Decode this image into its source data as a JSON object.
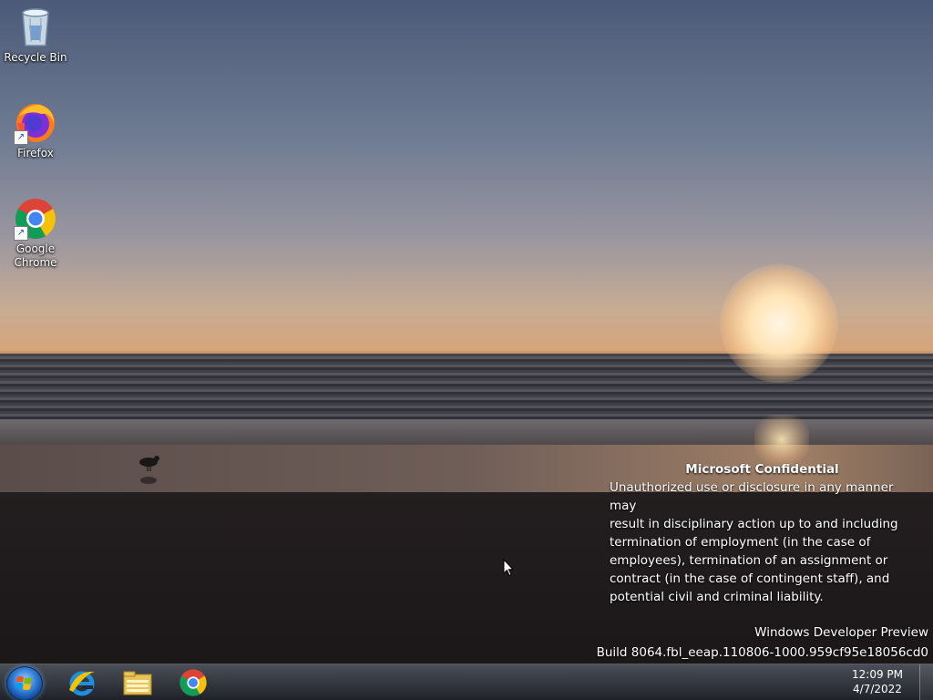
{
  "desktop": {
    "icons": [
      {
        "label": "Recycle Bin",
        "icon": "recycle-bin-icon"
      },
      {
        "label": "Firefox",
        "icon": "firefox-icon"
      },
      {
        "label": "Google Chrome",
        "icon": "chrome-icon"
      }
    ]
  },
  "watermark": {
    "confidential_title": "Microsoft Confidential",
    "confidential_lines": [
      "Unauthorized use or disclosure in any manner may",
      "result in disciplinary action up to and including",
      "termination of employment (in the case of",
      "employees), termination of an assignment or",
      "contract (in the case of contingent staff), and",
      "potential civil and criminal liability."
    ],
    "edition": "Windows Developer Preview",
    "build": "Build 8064.fbl_eeap.110806-1000.959cf95e18056cd0"
  },
  "taskbar": {
    "start": "start-button",
    "pinned": [
      {
        "name": "Internet Explorer",
        "icon": "internet-explorer-icon"
      },
      {
        "name": "File Explorer",
        "icon": "file-explorer-icon"
      },
      {
        "name": "Google Chrome",
        "icon": "chrome-icon"
      }
    ],
    "clock": {
      "time": "12:09 PM",
      "date": "4/7/2022"
    }
  }
}
